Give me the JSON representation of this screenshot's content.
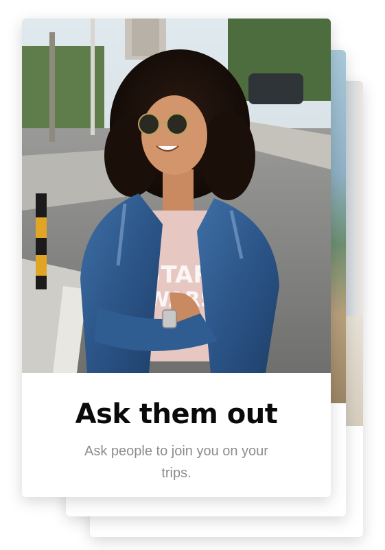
{
  "onboarding": {
    "title": "Ask them out",
    "subtitle": "Ask people to join you on your trips."
  },
  "cards": {
    "front_photo": "woman-curly-hair-denim-jacket-photo",
    "middle_photo": "beach-palm-trees-photo",
    "back_photo": "blue-sky-beach-photo"
  },
  "colors": {
    "title": "#0a0a0a",
    "subtitle": "#8c8c8c",
    "card_background": "#ffffff"
  }
}
